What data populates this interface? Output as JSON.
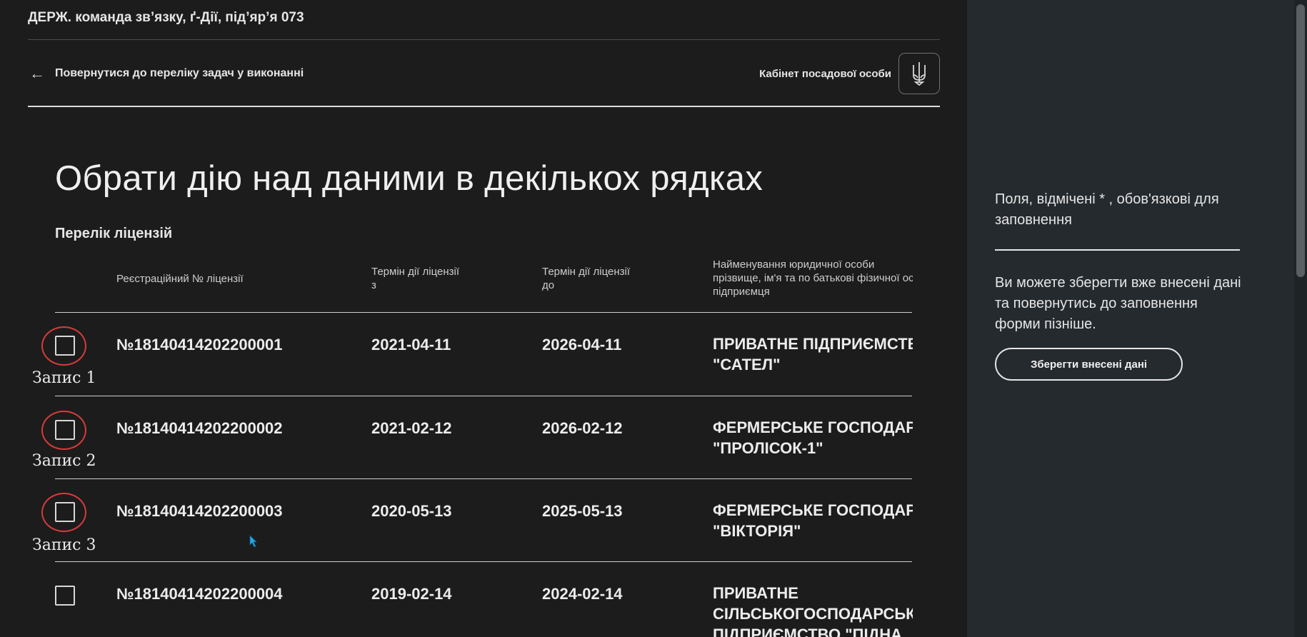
{
  "header": {
    "org": "ДЕРЖ. команда зв’язку, ґ-Дії, під’яр’я 073",
    "back_label": "Повернутися до переліку задач у виконанні",
    "cabinet_label": "Кабінет посадової особи"
  },
  "page": {
    "title": "Обрати дію над даними в декількох рядках",
    "subtitle": "Перелік ліцензій"
  },
  "table": {
    "columns": {
      "reg": "Реєстраційний № ліцензії",
      "from_line1": "Термін дії ліцензії",
      "from_line2": "з",
      "to_line1": "Термін дії ліцензії",
      "to_line2": "до",
      "name_line1": "Найменування юридичної особи",
      "name_line2": "прізвище, ім'я та по батькові фізичної особи",
      "name_line3": "підприємця"
    },
    "rows": [
      {
        "tag": "Запис 1",
        "reg": "№18140414202200001",
        "from": "2021-04-11",
        "to": "2026-04-11",
        "name1": "ПРИВАТНЕ ПІДПРИЄМСТВО",
        "name2": "\"САТЕЛ\""
      },
      {
        "tag": "Запис 2",
        "reg": "№18140414202200002",
        "from": "2021-02-12",
        "to": "2026-02-12",
        "name1": "ФЕРМЕРСЬКЕ ГОСПОДАРСТВО",
        "name2": "\"ПРОЛІСОК-1\""
      },
      {
        "tag": "Запис 3",
        "reg": "№18140414202200003",
        "from": "2020-05-13",
        "to": "2025-05-13",
        "name1": "ФЕРМЕРСЬКЕ ГОСПОДАРСТВО",
        "name2": "\"ВІКТОРІЯ\""
      },
      {
        "tag": "",
        "reg": "№18140414202200004",
        "from": "2019-02-14",
        "to": "2024-02-14",
        "name1": "ПРИВАТНЕ",
        "name2": "СІЛЬСЬКОГОСПОДАРСЬКЕ",
        "name3": "ПІДПРИЄМСТВО \"ПІДНА"
      }
    ]
  },
  "sidebar": {
    "required_note": "Поля, відмічені * , обов'язкові для заповнення",
    "save_note": "Ви можете зберегти вже внесені дані та повернутись до заповнення форми пізніше.",
    "save_button": "Зберегти внесені дані"
  },
  "colors": {
    "main_bg": "#1c1c1c",
    "side_bg": "#252a2e",
    "annotation_ring": "#d93a3a",
    "cursor": "#2aa3e6"
  }
}
